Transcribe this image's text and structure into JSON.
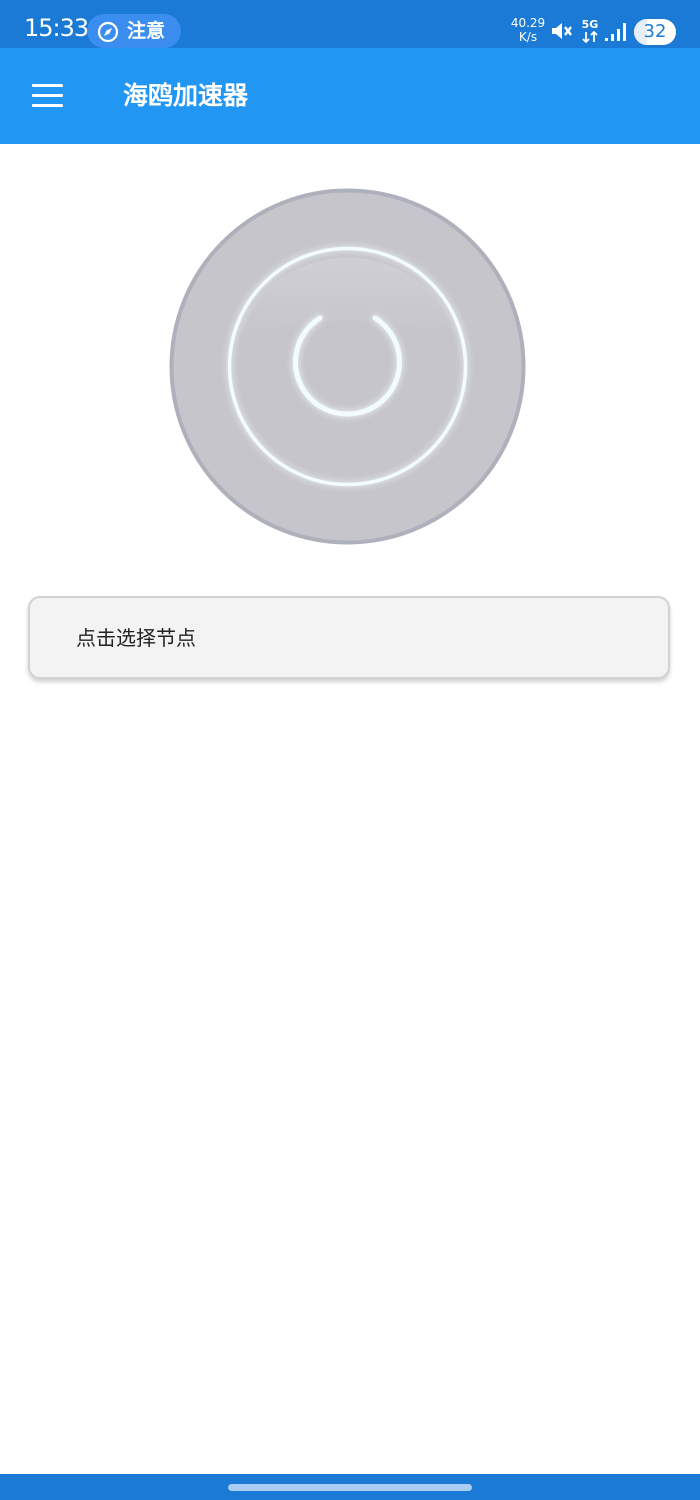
{
  "status_bar": {
    "time": "15:33",
    "notice_label": "注意",
    "net_speed_value": "40.29",
    "net_speed_unit": "K/s",
    "network_type": "5G",
    "battery_level": "32",
    "icons": [
      "compass-icon",
      "mute-icon",
      "data-arrows-icon",
      "signal-icon",
      "battery-icon"
    ]
  },
  "app_bar": {
    "title": "海鸥加速器",
    "menu_icon": "hamburger-menu-icon",
    "color": "#2196f3"
  },
  "main": {
    "power_button_icon": "power-icon",
    "node_selector_label": "点击选择节点"
  },
  "colors": {
    "status_bar": "#1a7ad6",
    "app_bar": "#2196f3",
    "power_disc": "#c6c5cc",
    "power_glow": "#eaf6ff"
  }
}
